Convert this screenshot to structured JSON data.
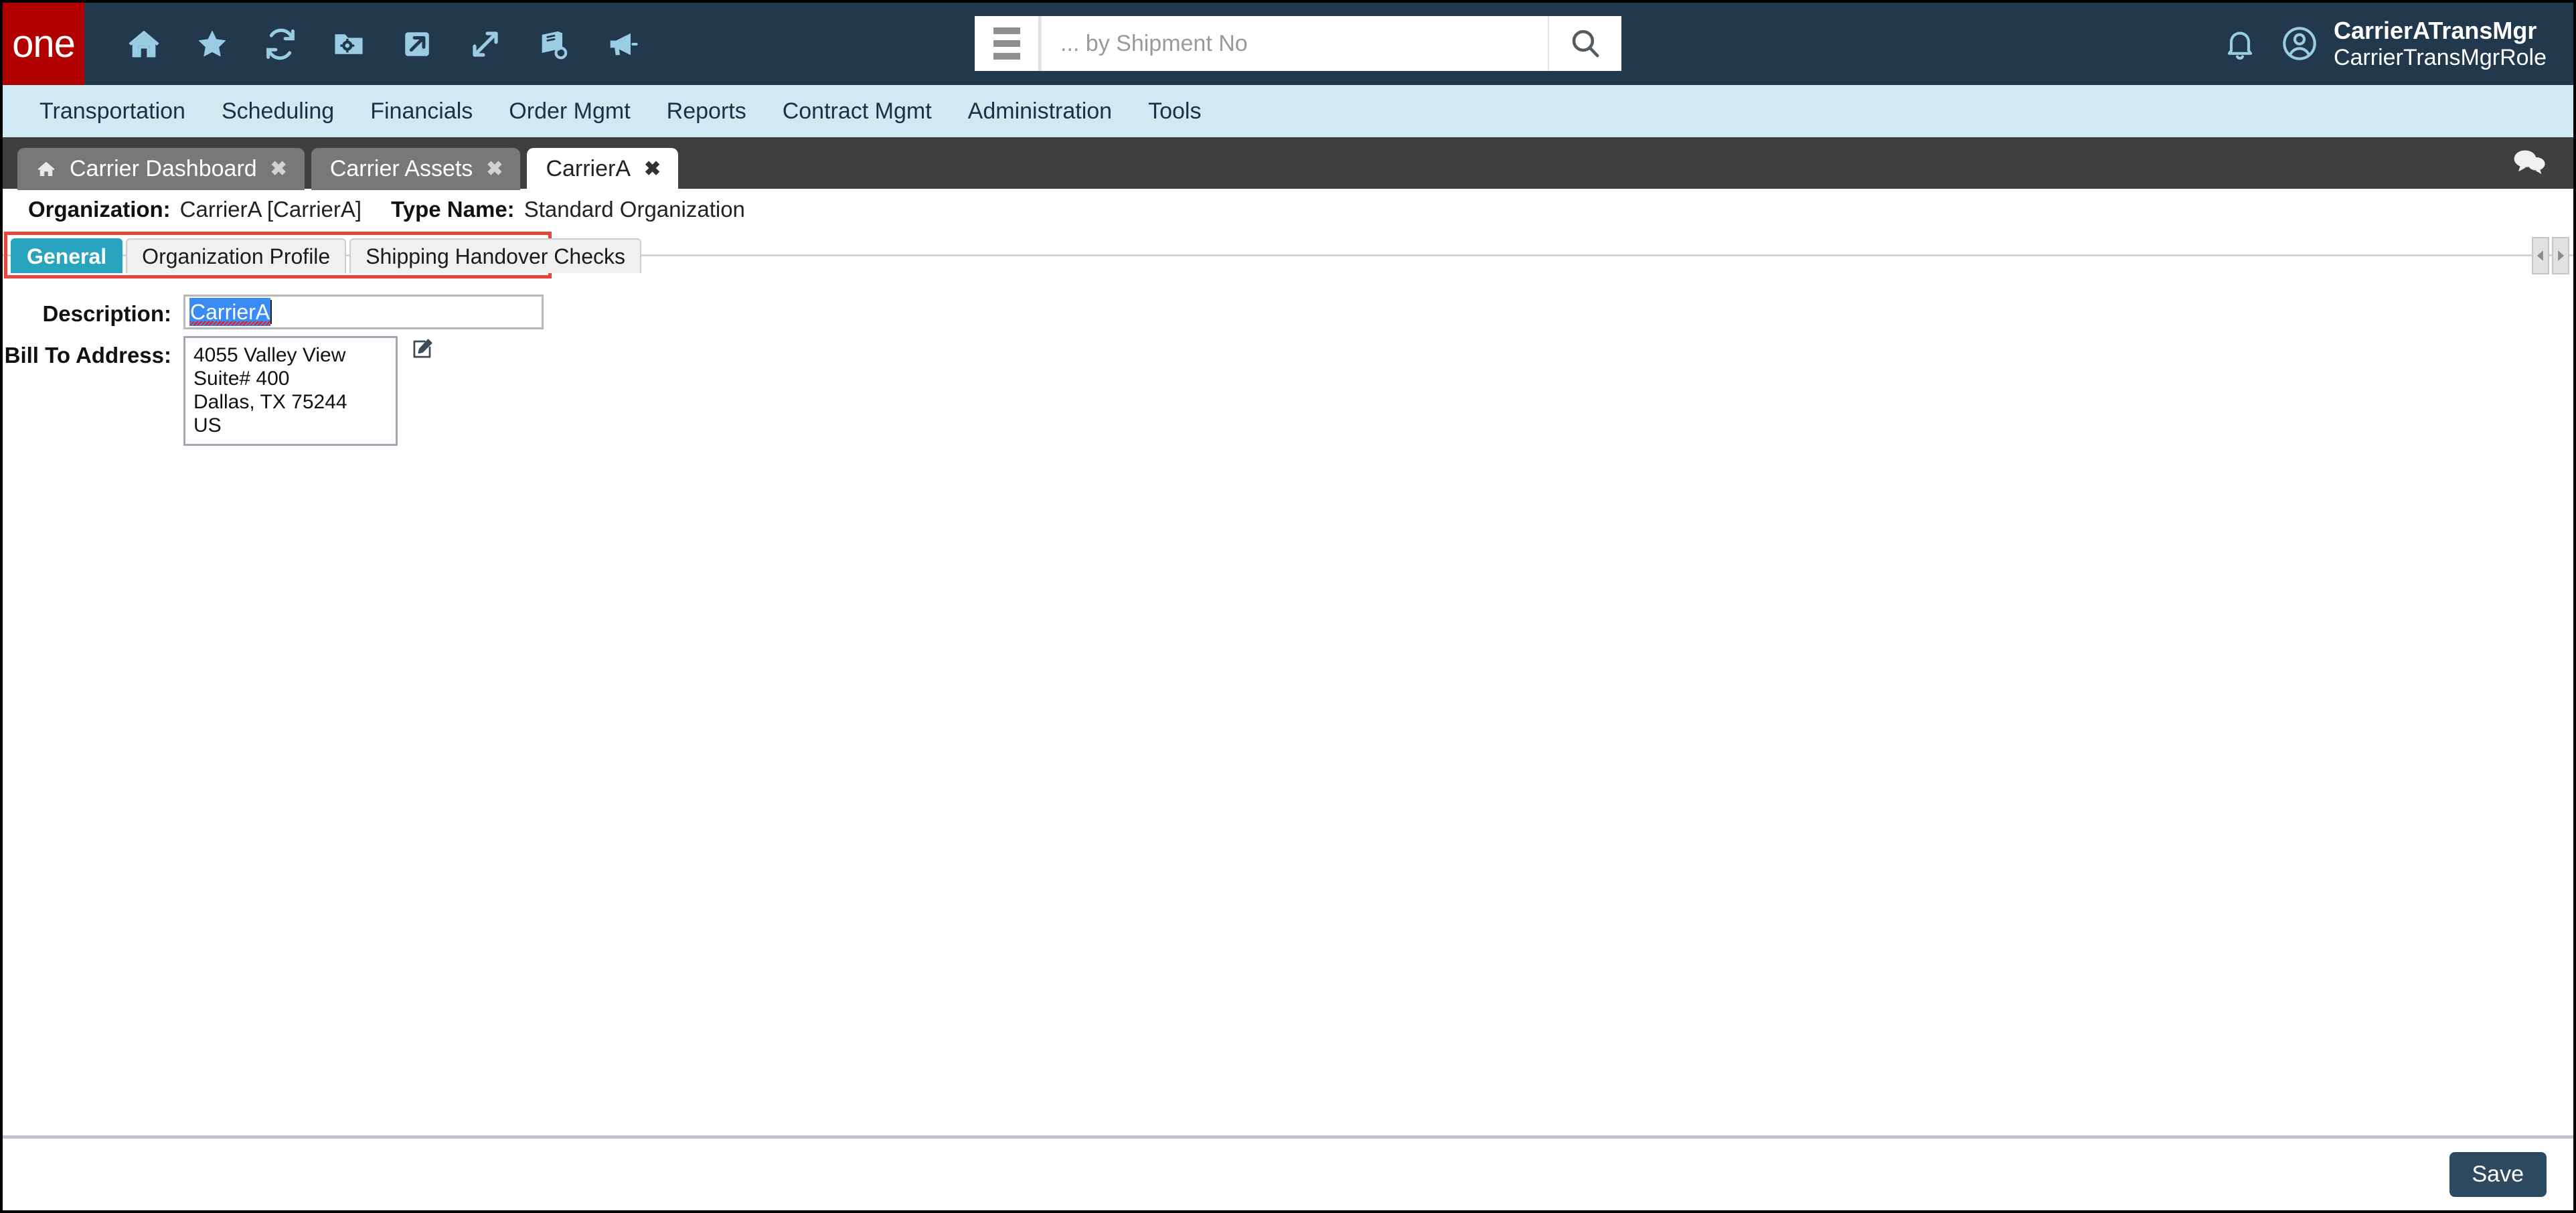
{
  "brand": {
    "logo_text": "one",
    "logo_bg": "#b00000",
    "header_bg": "#22384d",
    "icon_color": "#9acde4",
    "accent_teal": "#29a4bf",
    "annotation_red": "#e8453c",
    "selection_blue": "#3b8bf5",
    "save_bg": "#2e4a61"
  },
  "header": {
    "toolbar_icons": [
      {
        "name": "home-icon",
        "title": "Home"
      },
      {
        "name": "star-icon",
        "title": "Favorites"
      },
      {
        "name": "refresh-icon",
        "title": "Refresh"
      },
      {
        "name": "folder-gear-icon",
        "title": "Manage"
      },
      {
        "name": "shortcut-arrow-icon",
        "title": "Shortcut"
      },
      {
        "name": "expand-arrows-icon",
        "title": "Expand"
      },
      {
        "name": "book-search-icon",
        "title": "Help Search"
      },
      {
        "name": "megaphone-icon",
        "title": "Announcements"
      }
    ],
    "search": {
      "menu_icon": "hamburger-icon",
      "placeholder": "... by Shipment No",
      "value": "",
      "submit_icon": "search-icon"
    },
    "notifications_icon": "bell-icon",
    "user": {
      "avatar_icon": "user-circle-icon",
      "name": "CarrierATransMgr",
      "role": "CarrierTransMgrRole"
    }
  },
  "nav": {
    "items": [
      {
        "label": "Transportation"
      },
      {
        "label": "Scheduling"
      },
      {
        "label": "Financials"
      },
      {
        "label": "Order Mgmt"
      },
      {
        "label": "Reports"
      },
      {
        "label": "Contract Mgmt"
      },
      {
        "label": "Administration"
      },
      {
        "label": "Tools"
      }
    ]
  },
  "tabbar": {
    "tabs": [
      {
        "label": "Carrier Dashboard",
        "active": false,
        "has_home_icon": true,
        "close_label": "✖"
      },
      {
        "label": "Carrier Assets",
        "active": false,
        "has_home_icon": false,
        "close_label": "✖"
      },
      {
        "label": "CarrierA",
        "active": true,
        "has_home_icon": false,
        "close_label": "✖"
      }
    ],
    "chat_icon": "chat-bubbles-icon"
  },
  "orginfo": {
    "organization_label": "Organization:",
    "organization_value": "CarrierA [CarrierA]",
    "typename_label": "Type Name:",
    "typename_value": "Standard Organization"
  },
  "subtabs": {
    "items": [
      {
        "label": "General",
        "active": true
      },
      {
        "label": "Organization Profile",
        "active": false
      },
      {
        "label": "Shipping Handover Checks",
        "active": false
      }
    ],
    "scroll_left_label": "◀",
    "scroll_right_label": "▶"
  },
  "form": {
    "description": {
      "label": "Description:",
      "value": "CarrierA",
      "selected": true,
      "spellcheck_underline": true
    },
    "bill_to_address": {
      "label": "Bill To Address:",
      "lines": [
        "4055 Valley View",
        "Suite# 400",
        "Dallas, TX 75244",
        "US"
      ],
      "edit_icon": "edit-pencil-icon"
    }
  },
  "footer": {
    "save_label": "Save"
  }
}
